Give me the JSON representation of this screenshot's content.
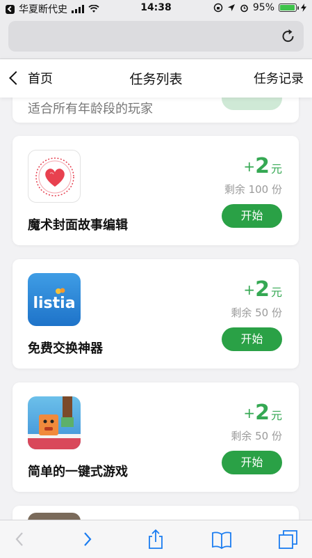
{
  "status": {
    "carrier": "华夏断代史",
    "time": "14:38",
    "battery": "95%",
    "battery_level": 0.95,
    "accent": "#3ec34b"
  },
  "nav": {
    "back_label": "首页",
    "title": "任务列表",
    "right_label": "任务记录"
  },
  "partial_card": {
    "subtitle": "适合所有年龄段的玩家"
  },
  "tasks": [
    {
      "name": "魔术封面故事编辑",
      "plus": "+",
      "amount": "2",
      "unit": "元",
      "remaining": "剩余 100 份",
      "button": "开始",
      "icon": "heart-stamp-icon"
    },
    {
      "name": "免费交换神器",
      "plus": "+",
      "amount": "2",
      "unit": "元",
      "remaining": "剩余 50 份",
      "button": "开始",
      "icon": "listia-logo-icon",
      "logo_text": "listia"
    },
    {
      "name": "简单的一键式游戏",
      "plus": "+",
      "amount": "2",
      "unit": "元",
      "remaining": "剩余 50 份",
      "button": "开始",
      "icon": "block-game-icon"
    }
  ],
  "colors": {
    "primary_green": "#2aa146",
    "reward_green": "#35a853",
    "background": "#f2f2f4"
  },
  "toolbar": [
    "back-arrow-icon",
    "forward-arrow-icon",
    "share-icon",
    "bookmarks-icon",
    "tabs-icon"
  ]
}
